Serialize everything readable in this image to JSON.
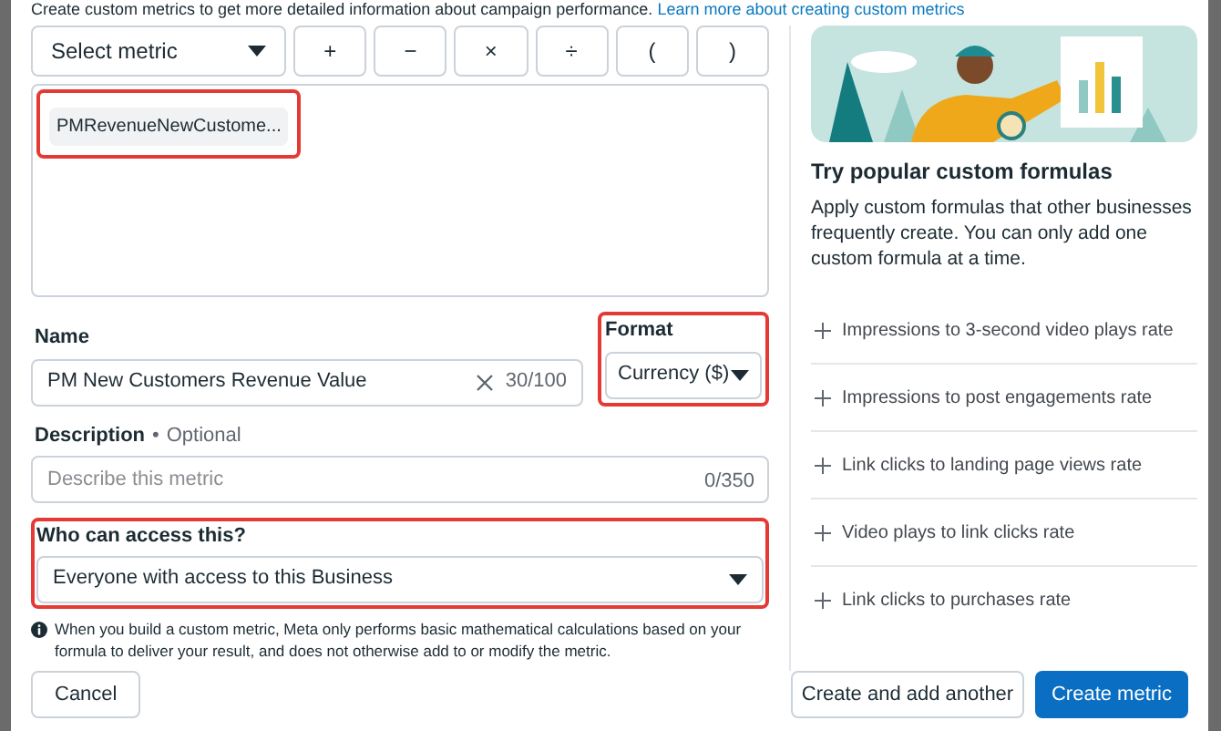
{
  "intro": {
    "text": "Create custom metrics to get more detailed information about campaign performance.",
    "link": "Learn more about creating custom metrics"
  },
  "formula": {
    "metric_select": "Select metric",
    "operators": [
      "+",
      "−",
      "×",
      "÷",
      "(",
      ")"
    ],
    "tokens": [
      {
        "label": "PMRevenueNewCustome...",
        "highlighted": true
      }
    ]
  },
  "name": {
    "label": "Name",
    "value": "PM New Customers Revenue Value",
    "counter": "30/100"
  },
  "format": {
    "label": "Format",
    "value": "Currency ($)",
    "highlighted": true
  },
  "description": {
    "label": "Description",
    "separator": "•",
    "optional": "Optional",
    "placeholder": "Describe this metric",
    "counter": "0/350"
  },
  "access": {
    "label": "Who can access this?",
    "value": "Everyone with access to this Business",
    "highlighted": true
  },
  "note": "When you build a custom metric, Meta only performs basic mathematical calculations based on your formula to deliver your result, and does not otherwise add to or modify the metric.",
  "sidebar": {
    "title": "Try popular custom formulas",
    "text": "Apply custom formulas that other businesses frequently create. You can only add one custom formula at a time.",
    "formulas": [
      "Impressions to 3-second video plays rate",
      "Impressions to post engagements rate",
      "Link clicks to landing page views rate",
      "Video plays to link clicks rate",
      "Link clicks to purchases rate"
    ]
  },
  "footer": {
    "cancel": "Cancel",
    "secondary": "Create and add another",
    "primary": "Create metric"
  }
}
